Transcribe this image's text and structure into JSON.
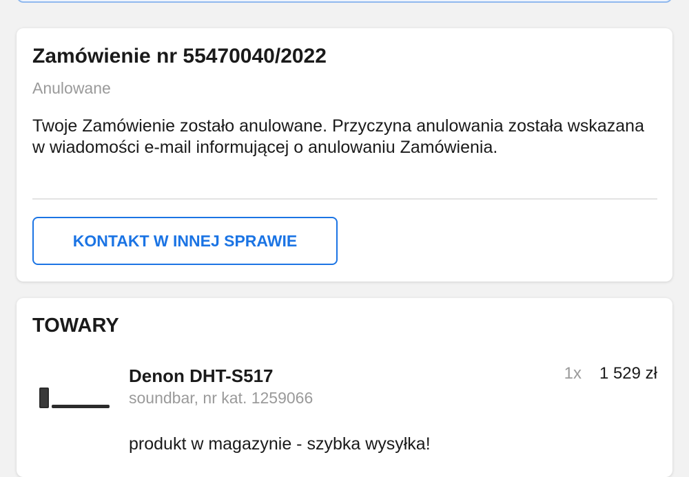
{
  "order": {
    "title": "Zamówienie nr 55470040/2022",
    "status": "Anulowane",
    "message": "Twoje Zamówienie zostało anulowane. Przyczyna anulowania została wskazana w wiadomości e-mail informującej o anulowaniu Zamówienia.",
    "contact_button_label": "KONTAKT W INNEJ SPRAWIE"
  },
  "items": {
    "title": "TOWARY",
    "list": [
      {
        "name": "Denon DHT-S517",
        "description": "soundbar, nr kat. 1259066",
        "quantity": "1x",
        "price": "1 529 zł",
        "availability": "produkt w magazynie - szybka wysyłka!",
        "thumbnail_icon": "soundbar-image"
      }
    ]
  },
  "colors": {
    "accent": "#1b74e4",
    "muted_text": "#9a9a9a",
    "background": "#f2f2f2"
  }
}
